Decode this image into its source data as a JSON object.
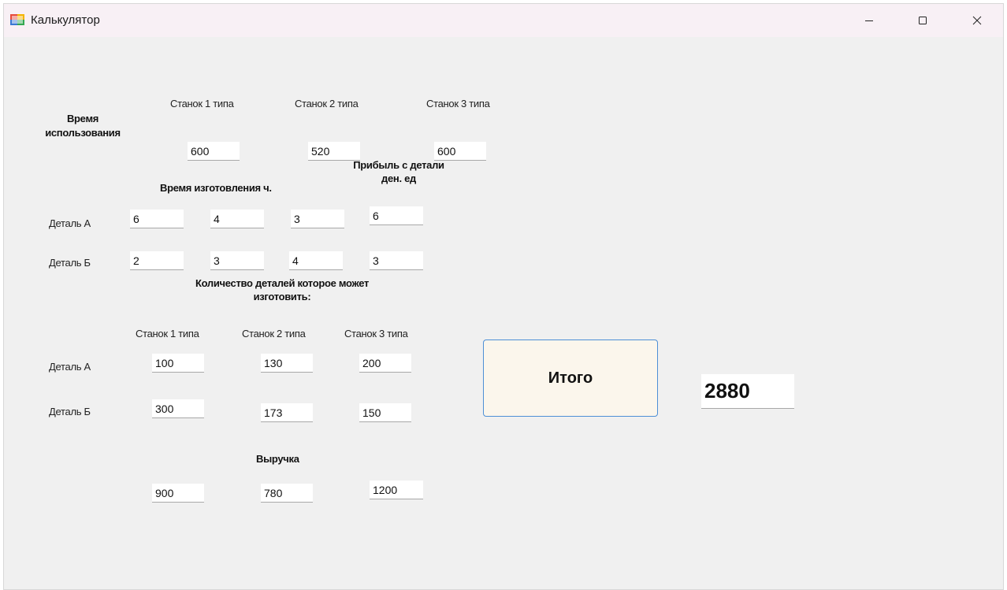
{
  "window": {
    "title": "Калькулятор",
    "controls": {
      "minimize": "—",
      "maximize": "☐",
      "close": "✕"
    }
  },
  "usage": {
    "label": "Время использования",
    "machine_headers": [
      "Станок 1 типа",
      "Станок 2 типа",
      "Станок 3 типа"
    ],
    "values": [
      "600",
      "520",
      "600"
    ]
  },
  "production": {
    "time_label": "Время изготовления ч.",
    "profit_label": "Прибыль с детали ден. ед",
    "rows": [
      {
        "label": "Деталь А",
        "times": [
          "6",
          "4",
          "3"
        ],
        "profit": "6"
      },
      {
        "label": "Деталь Б",
        "times": [
          "2",
          "3",
          "4"
        ],
        "profit": "3"
      }
    ]
  },
  "capacity": {
    "label": "Количество деталей которое может изготовить:",
    "machine_headers": [
      "Станок 1 типа",
      "Станок 2 типа",
      "Станок 3 типа"
    ],
    "rows": [
      {
        "label": "Деталь А",
        "values": [
          "100",
          "130",
          "200"
        ]
      },
      {
        "label": "Деталь Б",
        "values": [
          "300",
          "173",
          "150"
        ]
      }
    ]
  },
  "revenue": {
    "label": "Выручка",
    "values": [
      "900",
      "780",
      "1200"
    ]
  },
  "total": {
    "button_label": "Итого",
    "value": "2880"
  },
  "colors": {
    "background": "#f0f0f0",
    "titlebar": "#f8f0f5",
    "button_fill": "#fbf6ec",
    "button_border": "#4d8fd6"
  }
}
